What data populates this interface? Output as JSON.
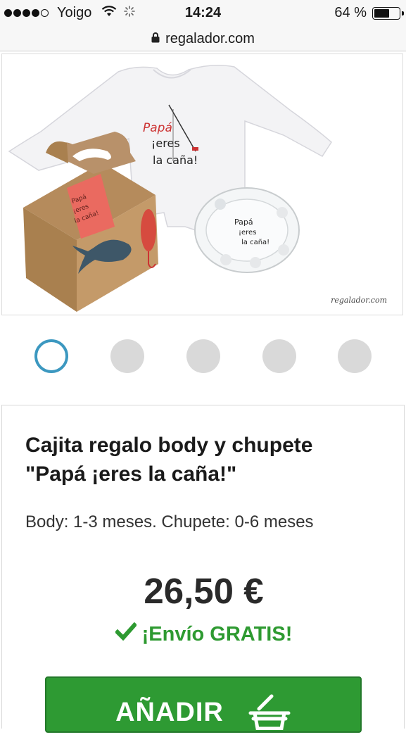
{
  "status_bar": {
    "carrier": "Yoigo",
    "time": "14:24",
    "battery": "64 %",
    "battery_level": 0.64,
    "signal_bars": 4
  },
  "browser": {
    "url": "regalador.com"
  },
  "product_image": {
    "onesie_text": [
      "Papá",
      "¡eres",
      "la caña!"
    ],
    "pacifier_text": [
      "Papá",
      "¡eres",
      "la caña!"
    ],
    "tag_text": [
      "Papá",
      "¡eres",
      "la caña!"
    ],
    "logo": "regalador.com"
  },
  "carousel": {
    "count": 5,
    "active_index": 0,
    "accent": "#3c98c0"
  },
  "product": {
    "title_line1": "Cajita regalo body y chupete",
    "title_line2": "\"Papá ¡eres la caña!\"",
    "subtitle": "Body: 1-3 meses. Chupete: 0-6 meses",
    "price": "26,50 €",
    "shipping": "¡Envío GRATIS!",
    "add_button_label": "AÑADIR",
    "colors": {
      "shipping": "#2e9a31",
      "button": "#2e9a33"
    }
  },
  "icons": {
    "wifi": "wifi-icon",
    "spinner": "activity-spinner-icon",
    "lock": "lock-icon",
    "check": "check-icon",
    "cart": "cart-icon"
  }
}
